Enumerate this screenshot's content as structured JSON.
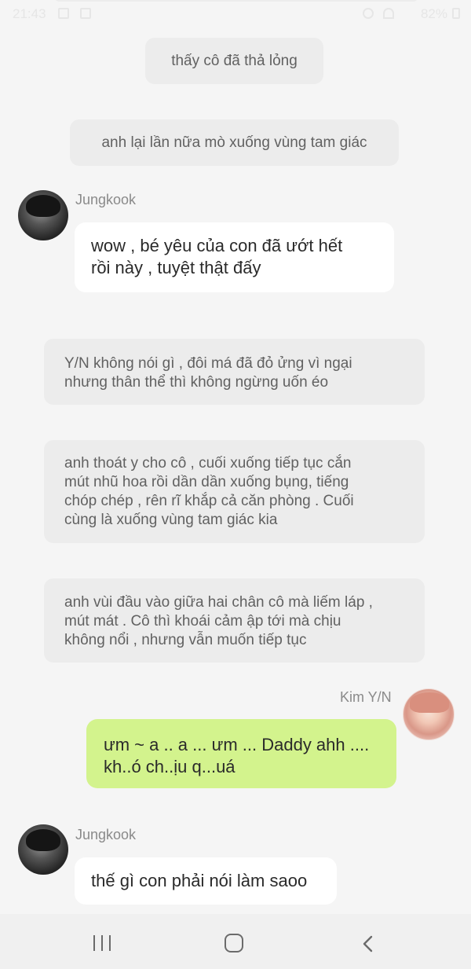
{
  "status_bar": {
    "time": "21:43",
    "battery": "82%"
  },
  "messages": [
    {
      "type": "narration",
      "text": "thấy cô đã thả lỏng"
    },
    {
      "type": "narration",
      "text": "anh lại lần nữa mò xuống vùng tam giác"
    },
    {
      "type": "incoming",
      "sender": "Jungkook",
      "line1": "wow , bé yêu của con đã ướt hết",
      "line2": "rồi này , tuyệt thật đấy"
    },
    {
      "type": "narration",
      "lines": [
        "Y/N không nói gì , đôi má đã đỏ ửng vì ngại",
        "nhưng thân thể thì không ngừng uốn éo"
      ]
    },
    {
      "type": "narration",
      "lines": [
        "anh thoát y cho cô , cuối xuống tiếp tục cắn",
        "mút nhũ hoa rồi dần dần xuống bụng, tiếng",
        "chóp chép , rên rĩ khắp cả căn phòng . Cuối",
        "cùng là xuống vùng tam giác kia"
      ]
    },
    {
      "type": "narration",
      "lines": [
        "anh vùi đầu vào giữa hai chân cô mà liếm láp ,",
        "mút mát . Cô thì khoái cảm ập tới mà chịu",
        "không nổi , nhưng vẫn muốn tiếp tục"
      ]
    },
    {
      "type": "outgoing",
      "sender": "Kim Y/N",
      "line1": "ưm ~ a .. a ... ưm ... Daddy ahh ....",
      "line2": "kh..ó ch..ịu q...uá"
    },
    {
      "type": "incoming",
      "sender": "Jungkook",
      "line1": "thế gì con phải nói làm saoo"
    }
  ],
  "nav": {
    "recent_icon": "recent-apps-icon",
    "home_icon": "home-icon",
    "back_icon": "back-icon"
  },
  "colors": {
    "background": "#f5f5f5",
    "narration_bg": "#ececec",
    "incoming_bubble": "#ffffff",
    "outgoing_bubble": "#d3f38d"
  }
}
